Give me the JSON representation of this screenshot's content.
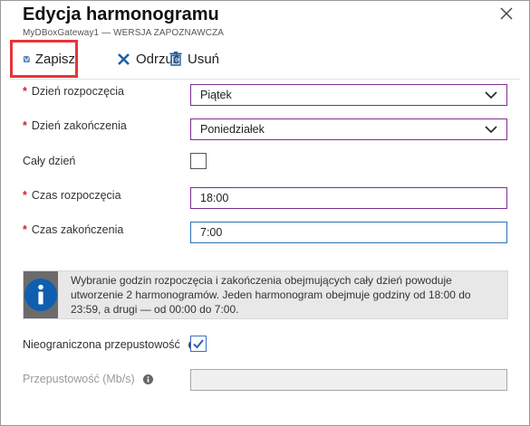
{
  "panel": {
    "title": "Edycja harmonogramu",
    "subtitle": "MyDBoxGateway1 — WERSJA ZAPOZNAWCZA"
  },
  "toolbar": {
    "save_label": "Zapisz",
    "discard_label": "Odrzuć",
    "delete_label": "Usuń"
  },
  "form": {
    "start_day": {
      "label": "Dzień rozpoczęcia",
      "value": "Piątek",
      "required_mark": "*"
    },
    "end_day": {
      "label": "Dzień zakończenia",
      "value": "Poniedziałek",
      "required_mark": "*"
    },
    "all_day": {
      "label": "Cały dzień",
      "checked": false
    },
    "start_time": {
      "label": "Czas rozpoczęcia",
      "value": "18:00",
      "required_mark": "*"
    },
    "end_time": {
      "label": "Czas zakończenia",
      "value": "7:00",
      "required_mark": "*"
    },
    "info_text": "Wybranie godzin rozpoczęcia i zakończenia obejmujących cały dzień powoduje utworzenie 2 harmonogramów. Jeden harmonogram obejmuje godziny od 18:00 do 23:59, a drugi — od 00:00 do 7:00.",
    "unlimited_bandwidth": {
      "label": "Nieograniczona przepustowość",
      "checked": true
    },
    "bandwidth": {
      "label": "Przepustowość (Mb/s)",
      "value": ""
    }
  },
  "icons": {
    "save": "floppy-disk-icon",
    "discard": "x-icon",
    "delete": "trash-icon",
    "close": "close-icon",
    "info": "info-icon",
    "chevron": "chevron-down-icon"
  },
  "colors": {
    "save_highlight": "#e8343a",
    "accent_blue": "#1f5fa8",
    "select_border": "#7a2f8f",
    "required": "#c4262e",
    "info_tile": "#0e5fb0"
  }
}
